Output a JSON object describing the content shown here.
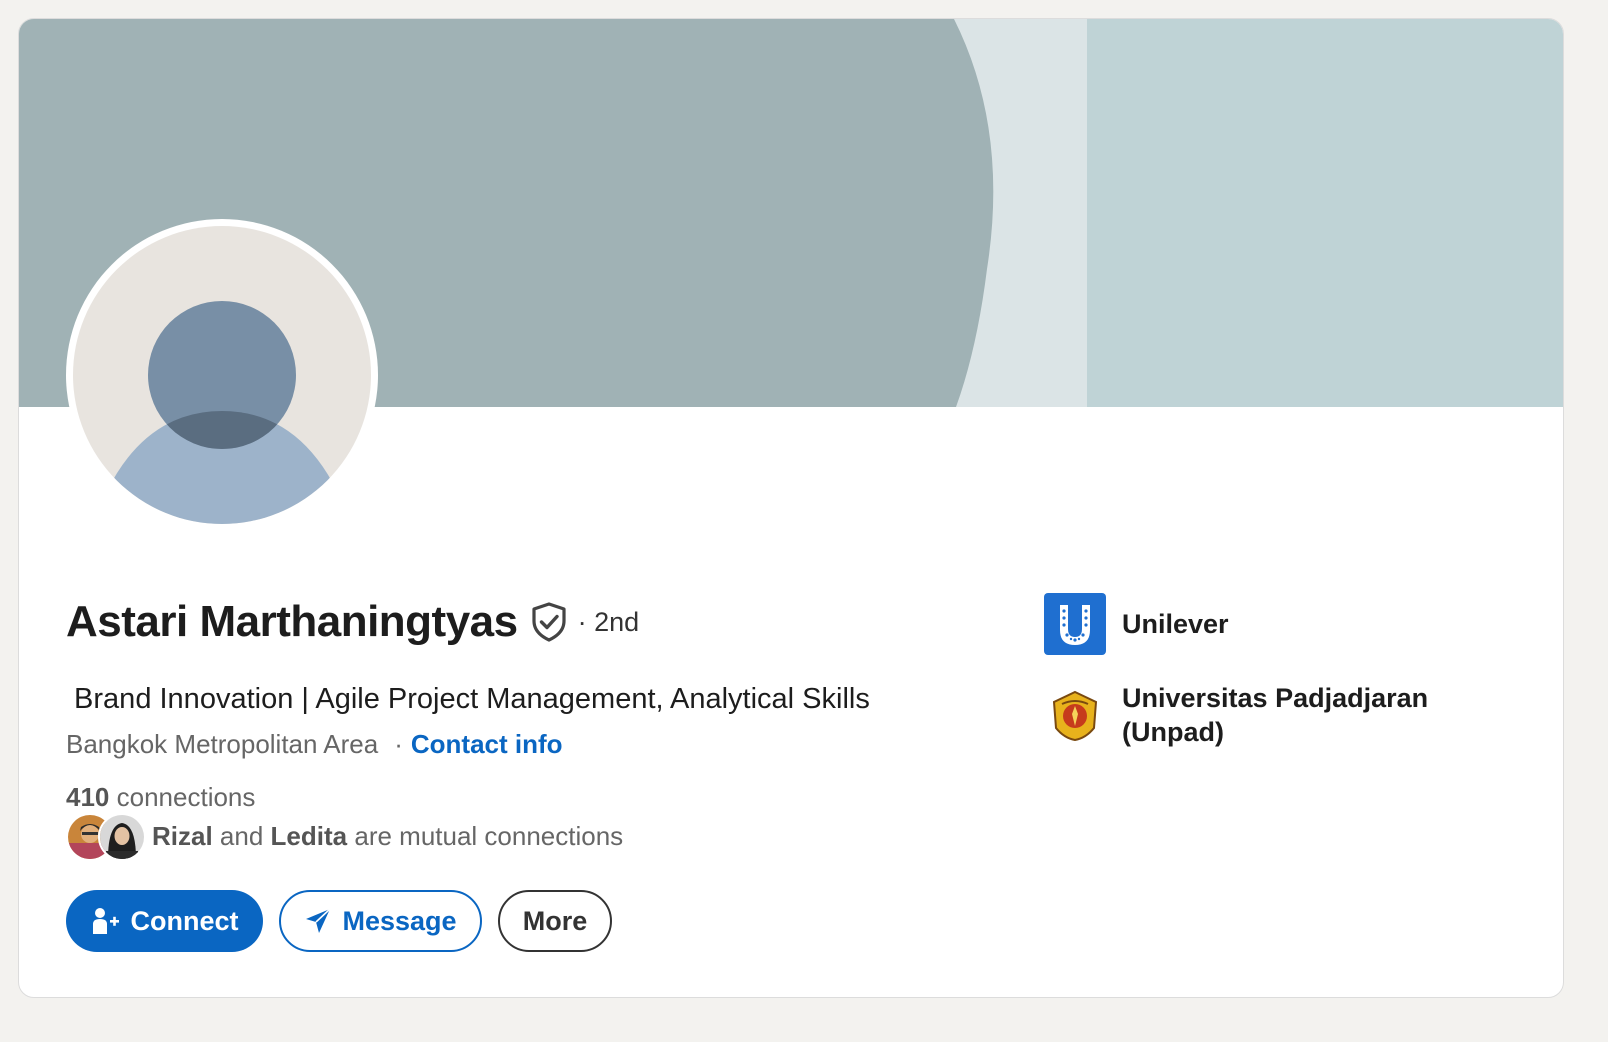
{
  "profile": {
    "name": "Astari Marthaningtyas",
    "degree": "· 2nd",
    "headline": " Brand Innovation | Agile Project Management, Analytical Skills",
    "location": "Bangkok Metropolitan Area",
    "separator": "·",
    "contact_info": "Contact info",
    "connections_count": "410",
    "connections_label": "connections"
  },
  "mutual": {
    "name1": "Rizal",
    "and": "and",
    "name2": "Ledita",
    "suffix": "are mutual connections"
  },
  "actions": {
    "connect": "Connect",
    "message": "Message",
    "more": "More"
  },
  "orgs": [
    {
      "name": "Unilever",
      "logo_color": "#1f6fd0"
    },
    {
      "name": "Universitas Padjadjaran (Unpad)"
    }
  ],
  "colors": {
    "accent": "#0a66c2",
    "banner_main": "#a0b2b5",
    "banner_light": "#dbe4e6",
    "banner_right": "#bfd3d6"
  }
}
